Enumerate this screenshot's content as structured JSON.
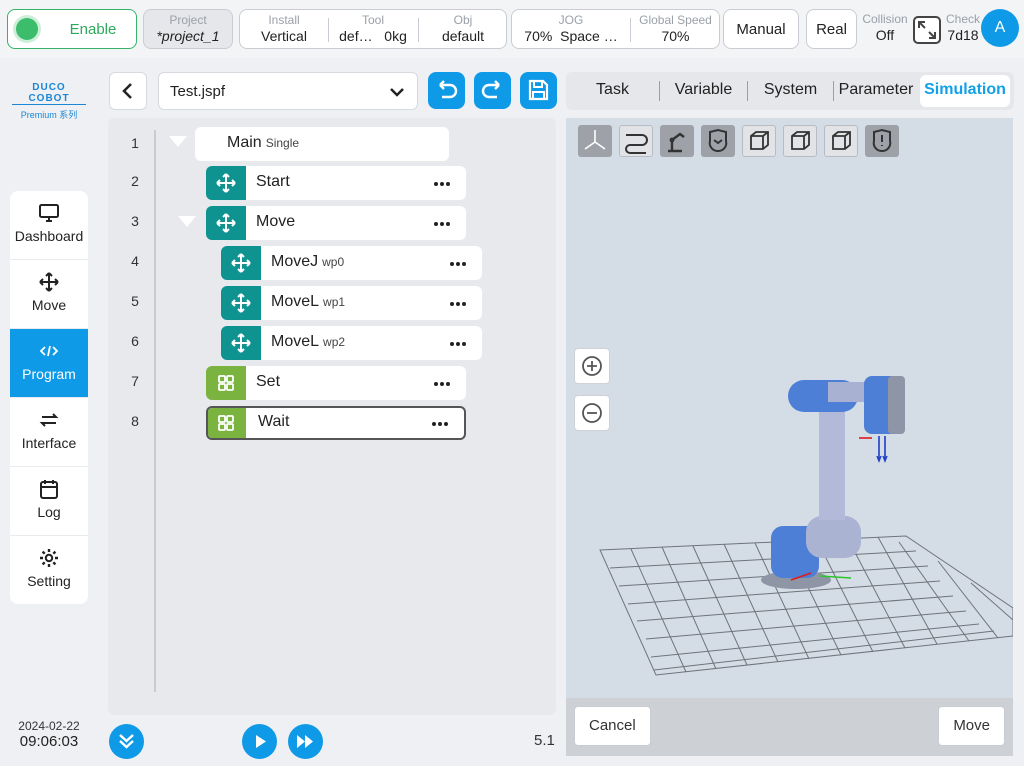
{
  "topbar": {
    "enable_label": "Enable",
    "project": {
      "label": "Project",
      "value": "*project_1"
    },
    "install": {
      "label": "Install",
      "value": "Vertical"
    },
    "tool": {
      "label": "Tool",
      "value": "def…",
      "payload": "0kg"
    },
    "obj": {
      "label": "Obj",
      "value": "default"
    },
    "jog": {
      "label": "JOG",
      "value": "70%",
      "mode": "Space …"
    },
    "global_speed": {
      "label": "Global Speed",
      "value": "70%"
    },
    "manual_label": "Manual",
    "real_label": "Real",
    "collision": {
      "label": "Collision",
      "value": "Off"
    },
    "check": {
      "label": "Check",
      "value": "7d18"
    },
    "avatar_letter": "A",
    "colors": {
      "enable": "#3bbd6b",
      "accent": "#0f9ae8"
    }
  },
  "logo": {
    "brand": "DUCO COBOT",
    "series": "Premium 系列"
  },
  "sidebar": {
    "items": [
      {
        "label": "Dashboard",
        "icon": "monitor-icon",
        "active": false
      },
      {
        "label": "Move",
        "icon": "move-arrows-icon",
        "active": false
      },
      {
        "label": "Program",
        "icon": "code-icon",
        "active": true
      },
      {
        "label": "Interface",
        "icon": "swap-arrows-icon",
        "active": false
      },
      {
        "label": "Log",
        "icon": "calendar-icon",
        "active": false
      },
      {
        "label": "Setting",
        "icon": "gear-icon",
        "active": false
      }
    ]
  },
  "program": {
    "file_name": "Test.jspf",
    "line_numbers": [
      "1",
      "2",
      "3",
      "4",
      "5",
      "6",
      "7",
      "8"
    ],
    "main": {
      "label": "Main",
      "sub": "Single"
    },
    "nodes": [
      {
        "label": "Start",
        "sub": "",
        "icon": "move-arrows-icon",
        "color": "#0e9390"
      },
      {
        "label": "Move",
        "sub": "",
        "icon": "move-arrows-icon",
        "color": "#0e9390"
      },
      {
        "label": "MoveJ",
        "sub": "wp0",
        "icon": "move-arrows-icon",
        "color": "#0e9390"
      },
      {
        "label": "MoveL",
        "sub": "wp1",
        "icon": "move-arrows-icon",
        "color": "#0e9390"
      },
      {
        "label": "MoveL",
        "sub": "wp2",
        "icon": "move-arrows-icon",
        "color": "#0e9390"
      },
      {
        "label": "Set",
        "sub": "",
        "icon": "grid-icon",
        "color": "#7ab340"
      },
      {
        "label": "Wait",
        "sub": "",
        "icon": "grid-icon",
        "color": "#7ab340",
        "selected": true
      }
    ],
    "version": "5.1"
  },
  "right": {
    "tabs": [
      "Task",
      "Variable",
      "System",
      "Parameter",
      "Simulation"
    ],
    "active_tab": "Simulation",
    "cancel_label": "Cancel",
    "move_label": "Move"
  }
}
